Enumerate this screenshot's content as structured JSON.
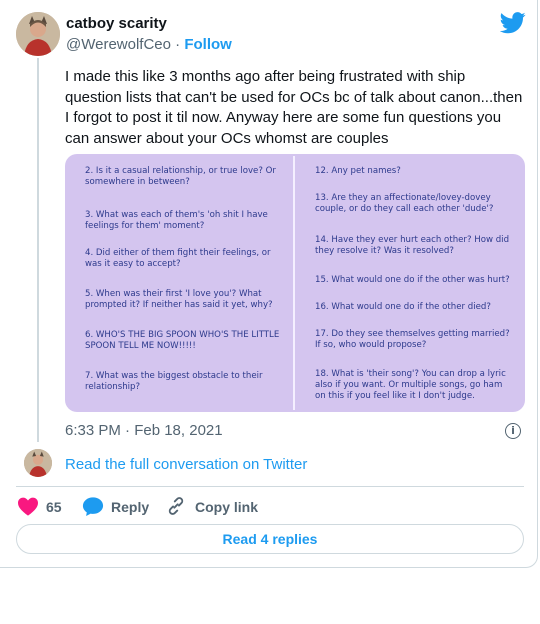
{
  "tweet": {
    "display_name": "catboy scarity",
    "handle": "@WerewolfCeo",
    "separator": "·",
    "follow_label": "Follow",
    "text": "I made this like 3 months ago after being frustrated with ship question lists that can't be used for OCs bc of talk about canon...then I forgot to post it til now. Anyway here are some fun questions you can answer about your OCs whomst are couples",
    "timestamp": "6:33 PM · Feb 18, 2021",
    "read_conversation": "Read the full conversation on Twitter",
    "like_count": "65",
    "reply_label": "Reply",
    "copy_link_label": "Copy link",
    "read_replies_label": "Read 4 replies"
  },
  "image": {
    "left_questions": [
      "2. Is it a casual relationship, or true love? Or somewhere in between?",
      "3. What was each of them's 'oh shit I have feelings for them' moment?",
      "4. Did either of them fight their feelings, or was it easy to accept?",
      "5. When was their first 'I love you'? What prompted it? If neither has said it yet, why?",
      "6. WHO'S THE BIG SPOON WHO'S THE LITTLE SPOON TELL ME NOW!!!!!",
      "7. What was the biggest obstacle to their relationship?"
    ],
    "right_questions": [
      "12. Any pet names?",
      "13. Are they an affectionate/lovey-dovey couple, or do they call each other 'dude'?",
      "14. Have they ever hurt each other? How did they resolve it? Was it resolved?",
      "15. What would one do if the other was hurt?",
      "16. What would one do if the other died?",
      "17. Do they see themselves getting married? If so, who would propose?",
      "18. What is 'their song'? You can drop a lyric also if you want. Or multiple songs, go ham on this if you feel like it I don't judge."
    ]
  },
  "colors": {
    "accent": "#1d9bf0",
    "like": "#f91880",
    "image_bg": "#d4c5ef",
    "image_text": "#2d3a8c",
    "secondary_text": "#536471"
  },
  "icons": {
    "brand": "twitter-bird-icon",
    "like": "heart-icon",
    "reply": "speech-bubble-icon",
    "copy": "link-icon",
    "info": "info-icon"
  }
}
